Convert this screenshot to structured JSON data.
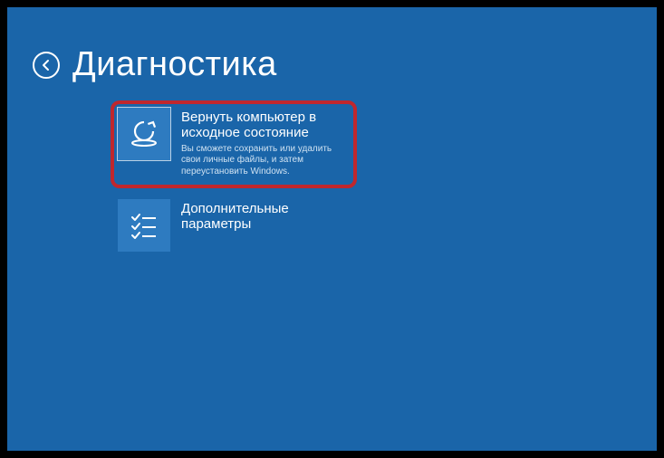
{
  "header": {
    "title": "Диагностика"
  },
  "options": [
    {
      "title": "Вернуть компьютер в исходное состояние",
      "desc": "Вы сможете сохранить или удалить свои личные файлы, и затем переустановить Windows."
    },
    {
      "title": "Дополнительные параметры",
      "desc": ""
    }
  ]
}
